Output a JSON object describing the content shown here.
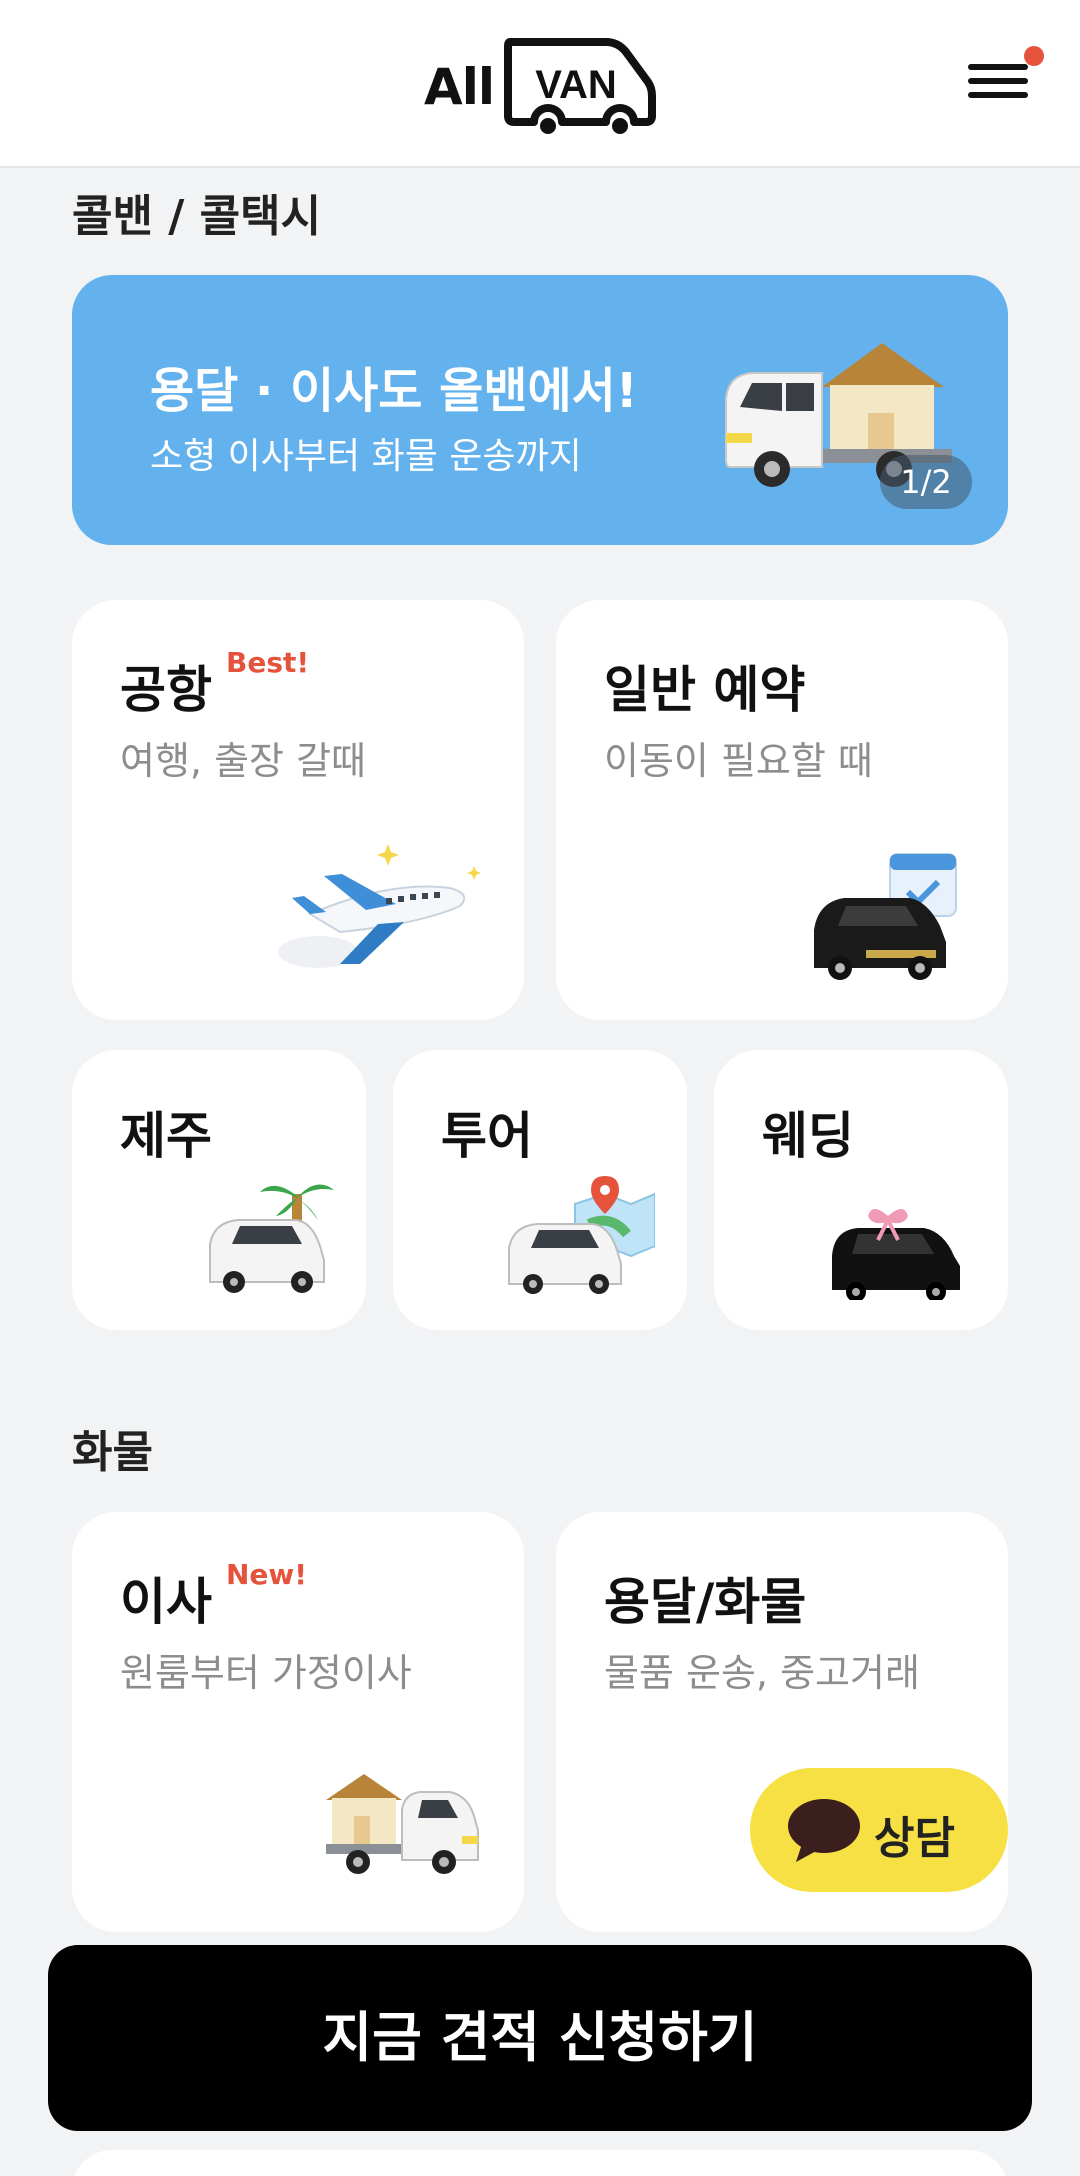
{
  "header": {
    "logo_all": "All",
    "logo_van": "VAN",
    "menu_icon": "hamburger-menu-icon",
    "notification_color": "#e5533d"
  },
  "section_van": {
    "title": "콜밴 / 콜택시"
  },
  "banner": {
    "title": "용달 · 이사도 올밴에서!",
    "subtitle": "소형 이사부터 화물 운송까지",
    "pager": "1/2",
    "color": "#63b2ee",
    "icon": "moving-truck-icon"
  },
  "van_services": [
    {
      "title": "공항",
      "badge": "Best!",
      "subtitle": "여행, 출장 갈때",
      "icon": "airplane-icon"
    },
    {
      "title": "일반 예약",
      "badge": "",
      "subtitle": "이동이 필요할 때",
      "icon": "van-calendar-icon"
    },
    {
      "title": "제주",
      "icon": "van-palm-tree-icon"
    },
    {
      "title": "투어",
      "icon": "van-map-icon"
    },
    {
      "title": "웨딩",
      "icon": "wedding-van-icon"
    }
  ],
  "section_cargo": {
    "title": "화물"
  },
  "cargo_services": [
    {
      "title": "이사",
      "badge": "New!",
      "subtitle": "원룸부터 가정이사",
      "icon": "moving-truck-icon"
    },
    {
      "title": "용달/화물",
      "badge": "",
      "subtitle": "물품 운송, 중고거래",
      "icon": "cargo-truck-icon"
    }
  ],
  "chat_button": {
    "label": "상담",
    "color": "#f6e044"
  },
  "cta": {
    "label": "지금 견적 신청하기"
  }
}
